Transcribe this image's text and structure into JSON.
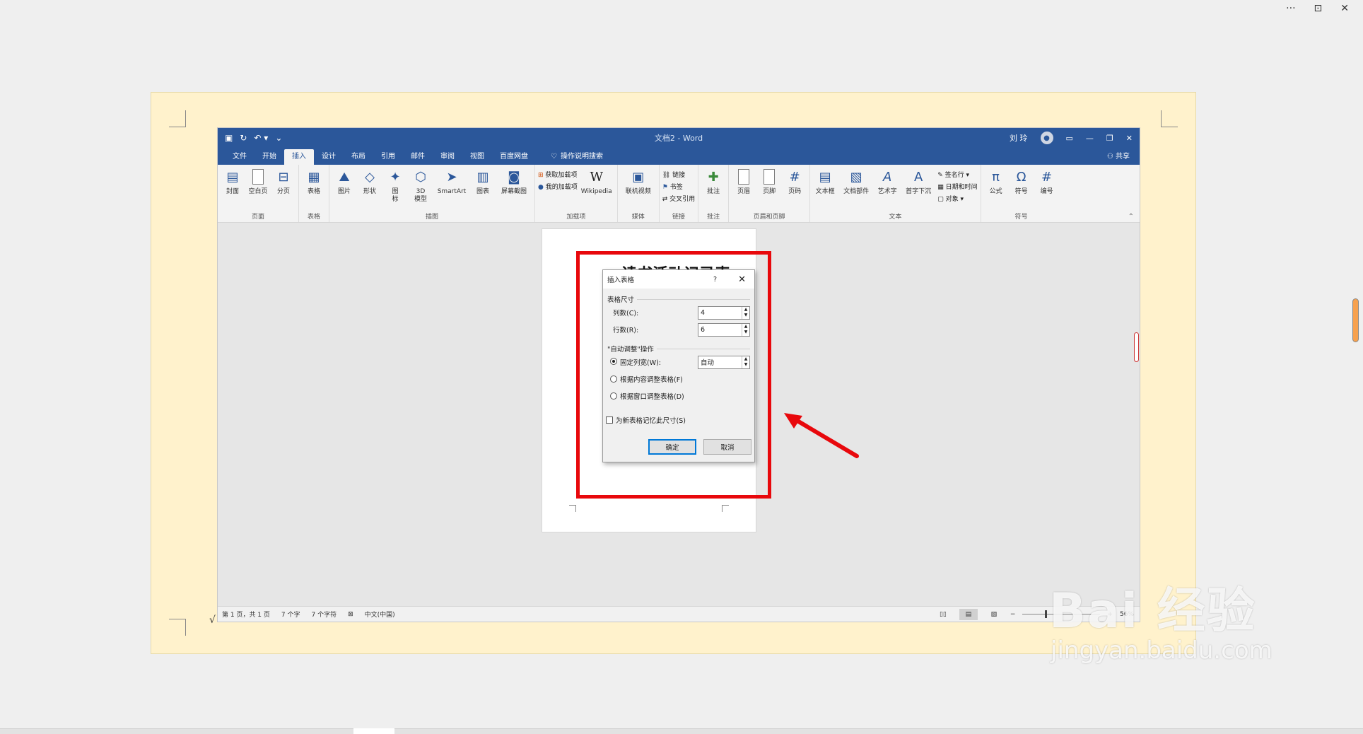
{
  "outer": {
    "more": "···",
    "restore": "⊡",
    "close": "✕"
  },
  "title_bar": {
    "doc_title": "文档2 - Word",
    "user": "刘 玲"
  },
  "tabs": [
    "文件",
    "开始",
    "插入",
    "设计",
    "布局",
    "引用",
    "邮件",
    "审阅",
    "视图",
    "百度网盘"
  ],
  "tab_search": "操作说明搜索",
  "share": "共享",
  "ribbon": {
    "page": {
      "label": "页面",
      "items": [
        "封面",
        "空白页",
        "分页"
      ]
    },
    "table": {
      "label": "表格",
      "items": [
        "表格"
      ]
    },
    "illustrations": {
      "label": "插图",
      "items": [
        "图片",
        "形状",
        "图\n标",
        "3D\n模型",
        "SmartArt",
        "图表",
        "屏幕截图"
      ]
    },
    "addins": {
      "label": "加载项",
      "get": "获取加载项",
      "mine": "我的加载项",
      "wiki": "Wikipedia"
    },
    "media": {
      "label": "媒体",
      "items": [
        "联机视频"
      ]
    },
    "links": {
      "label": "链接",
      "items": [
        "链接",
        "书签",
        "交叉引用"
      ]
    },
    "comments": {
      "label": "批注",
      "items": [
        "批注"
      ]
    },
    "header_footer": {
      "label": "页眉和页脚",
      "items": [
        "页眉",
        "页脚",
        "页码"
      ]
    },
    "text": {
      "label": "文本",
      "items": [
        "文本框",
        "文档部件",
        "艺术字",
        "首字下沉"
      ],
      "small": [
        "签名行",
        "日期和时间",
        "对象"
      ]
    },
    "symbols": {
      "label": "符号",
      "items": [
        "公式",
        "符号",
        "编号"
      ]
    }
  },
  "document": {
    "title": "读书活动记录表"
  },
  "dialog": {
    "title": "插入表格",
    "help": "?",
    "section_size": "表格尺寸",
    "columns_label": "列数(C):",
    "columns_value": "4",
    "rows_label": "行数(R):",
    "rows_value": "6",
    "section_autofit": "\"自动调整\"操作",
    "fixed_label": "固定列宽(W):",
    "fixed_value": "自动",
    "autofit_content": "根据内容调整表格(F)",
    "autofit_window": "根据窗口调整表格(D)",
    "remember": "为新表格记忆此尺寸(S)",
    "ok": "确定",
    "cancel": "取消"
  },
  "status": {
    "page": "第 1 页，共 1 页",
    "words": "7 个字",
    "chars": "7 个字符",
    "lang": "中文(中国)",
    "zoom": "56%",
    "minus": "−",
    "plus": "+"
  },
  "check": "√",
  "watermark": {
    "brand": "Bai 经验",
    "url": "jingyan.baidu.com"
  },
  "colors": {
    "word_blue": "#2b579a",
    "annotation_red": "#e8080c",
    "cream": "#fff2cc"
  }
}
